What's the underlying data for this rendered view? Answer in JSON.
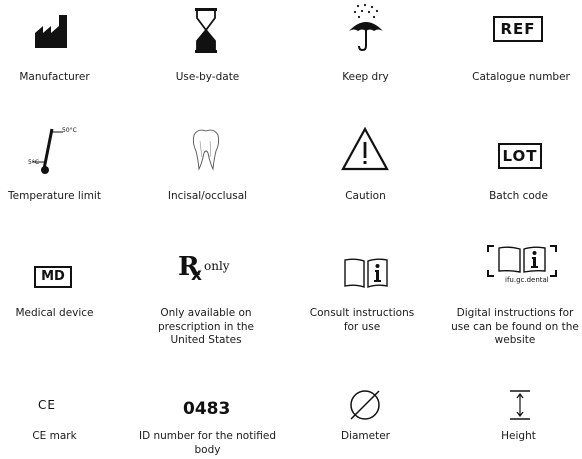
{
  "symbols": [
    {
      "icon": "manufacturer-icon",
      "label": "Manufacturer"
    },
    {
      "icon": "hourglass-icon",
      "label": "Use-by-date"
    },
    {
      "icon": "umbrella-rain-icon",
      "label": "Keep dry"
    },
    {
      "icon": "ref-box-icon",
      "label": "Catalogue number",
      "code": "REF"
    },
    {
      "icon": "thermometer-icon",
      "label": "Temperature limit",
      "low": "5°C",
      "high": "50°C"
    },
    {
      "icon": "tooth-icon",
      "label": "Incisal/occlusal"
    },
    {
      "icon": "caution-triangle-icon",
      "label": "Caution"
    },
    {
      "icon": "lot-box-icon",
      "label": "Batch code",
      "code": "LOT"
    },
    {
      "icon": "md-box-icon",
      "label": "Medical device",
      "code": "MD"
    },
    {
      "icon": "rx-icon",
      "label": "Only available on prescription in the United States",
      "mark": "R",
      "suffix": "only"
    },
    {
      "icon": "book-info-icon",
      "label": "Consult instructions for use"
    },
    {
      "icon": "eifu-icon",
      "label": "Digital instructions for use can be found on the website",
      "url": "ifu.gc.dental"
    },
    {
      "icon": "ce-mark-icon",
      "label": "CE mark",
      "mark": "CE"
    },
    {
      "icon": "notified-body-number",
      "label": "ID number for the notified body",
      "number": "0483"
    },
    {
      "icon": "diameter-icon",
      "label": "Diameter"
    },
    {
      "icon": "height-icon",
      "label": "Height"
    }
  ]
}
